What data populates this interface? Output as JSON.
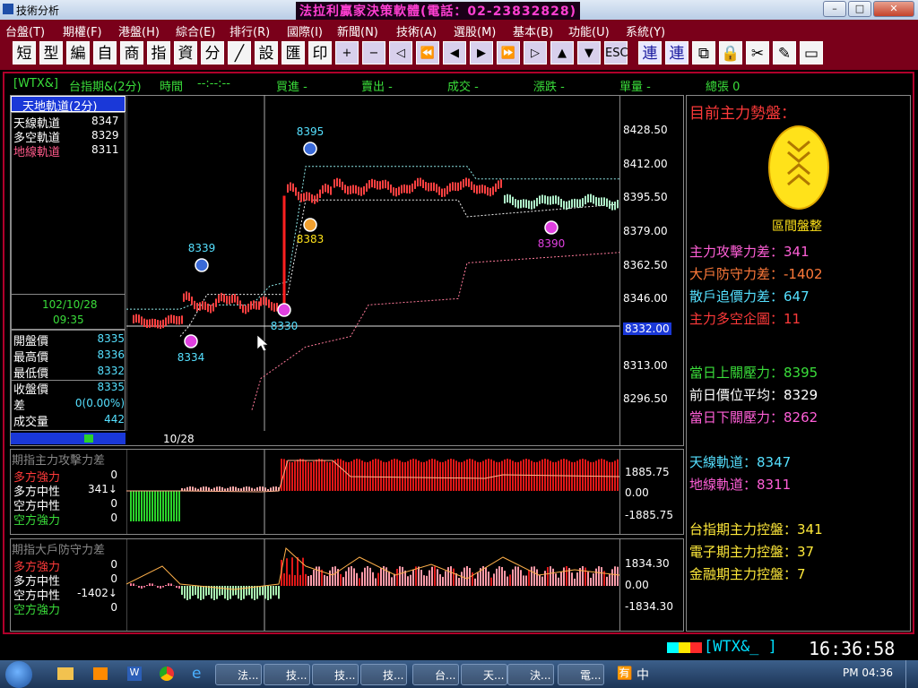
{
  "window": {
    "title": "技術分析",
    "banner": "法拉利贏家決策軟體(電話：02-23832828)"
  },
  "menu": [
    "台盤(T)",
    "期權(F)",
    "港盤(H)",
    "綜合(E)",
    "排行(R)",
    "國際(I)",
    "新聞(N)",
    "技術(A)",
    "選股(M)",
    "基本(B)",
    "功能(U)",
    "系統(Y)"
  ],
  "toolbar": [
    "短",
    "型",
    "編",
    "自",
    "商",
    "指",
    "資",
    "分",
    "╱",
    "設",
    "匯",
    "印",
    "+",
    "−",
    "◁",
    "⏪",
    "◀",
    "▶",
    "⏩",
    "▷",
    "▲",
    "▼",
    "ESC",
    "連",
    "連",
    "⧉",
    "🔒",
    "✂",
    "✎",
    "▭"
  ],
  "header": {
    "symbol": "[WTX&]",
    "name": "台指期&(2分)",
    "time_label": "時間",
    "time_val": "--:--:--",
    "buy": "買進 -",
    "sell": "賣出 -",
    "deal": "成交 -",
    "change": "漲跌 -",
    "qty": "單量 -",
    "total": "總張 0"
  },
  "info_box": {
    "title": "天地軌道(2分)",
    "rows": [
      {
        "label": "天線軌道",
        "value": "8347",
        "color": "#ffffff"
      },
      {
        "label": "多空軌道",
        "value": "8329",
        "color": "#ffffff"
      },
      {
        "label": "地線軌道",
        "value": "8311",
        "color": "#ff5a8a"
      }
    ],
    "date": "102/10/28",
    "time": "09:35",
    "quote": [
      {
        "label": "開盤價",
        "value": "8335"
      },
      {
        "label": "最高價",
        "value": "8336"
      },
      {
        "label": "最低價",
        "value": "8332"
      },
      {
        "label": "收盤價",
        "value": "8335"
      },
      {
        "label": "差",
        "value": "0(0.00%)"
      },
      {
        "label": "成交量",
        "value": "442"
      }
    ]
  },
  "price_axis": {
    "ticks": [
      "8428.50",
      "8412.00",
      "8395.50",
      "8379.00",
      "8362.50",
      "8346.00",
      "8332.00",
      "8313.00",
      "8296.50"
    ],
    "current": "8332.00"
  },
  "date_axis": {
    "label": "10/28"
  },
  "markers": [
    {
      "text": "8395"
    },
    {
      "text": "8383"
    },
    {
      "text": "8339"
    },
    {
      "text": "8330"
    },
    {
      "text": "8334"
    },
    {
      "text": "8390"
    }
  ],
  "sub1": {
    "title": "期指主力攻擊力差",
    "rows": [
      {
        "label": "多方強力",
        "value": "0",
        "color": "#ff3a3a"
      },
      {
        "label": "多方中性",
        "value": "341↓",
        "color": "#ffffff"
      },
      {
        "label": "空方中性",
        "value": "0",
        "color": "#ffffff"
      },
      {
        "label": "空方強力",
        "value": "0",
        "color": "#3ade3a"
      }
    ],
    "ticks": [
      "1885.75",
      "0.00",
      "-1885.75"
    ]
  },
  "sub2": {
    "title": "期指大戶防守力差",
    "rows": [
      {
        "label": "多方強力",
        "value": "0",
        "color": "#ff3a3a"
      },
      {
        "label": "多方中性",
        "value": "0",
        "color": "#ffffff"
      },
      {
        "label": "空方中性",
        "value": "-1402↓",
        "color": "#ffffff"
      },
      {
        "label": "空方強力",
        "value": "0",
        "color": "#3ade3a"
      }
    ],
    "ticks": [
      "1834.30",
      "0.00",
      "-1834.30"
    ]
  },
  "right": {
    "title": "目前主力勢盤：",
    "badge": "區間盤整",
    "lines": [
      {
        "text": "主力攻擊力差：341",
        "color": "#ff5fd7"
      },
      {
        "text": "大戶防守力差：-1402",
        "color": "#ff7a3a"
      },
      {
        "text": "散戶追價力差：647",
        "color": "#55e0ff"
      },
      {
        "text": "主力多空企圖：11",
        "color": "#ff3a3a"
      },
      {
        "text": "當日上關壓力：8395",
        "color": "#3ade3a"
      },
      {
        "text": "前日價位平均：8329",
        "color": "#ffffff"
      },
      {
        "text": "當日下關壓力：8262",
        "color": "#ff5fd7"
      },
      {
        "text": "天線軌道：8347",
        "color": "#55e0ff"
      },
      {
        "text": "地線軌道：8311",
        "color": "#ff5fd7"
      },
      {
        "text": "台指期主力控盤：341",
        "color": "#ffe93a"
      },
      {
        "text": "電子期主力控盤：37",
        "color": "#ffe93a"
      },
      {
        "text": "金融期主力控盤：7",
        "color": "#ffe93a"
      }
    ]
  },
  "status": {
    "symbol": "[WTX&_  ]",
    "clock": "16:36:58"
  },
  "taskbar": {
    "tasks": [
      "法...",
      "技...",
      "技...",
      "技...",
      "台...",
      "天...",
      "決...",
      "電..."
    ],
    "lang": "中",
    "time": "PM 04:36"
  }
}
